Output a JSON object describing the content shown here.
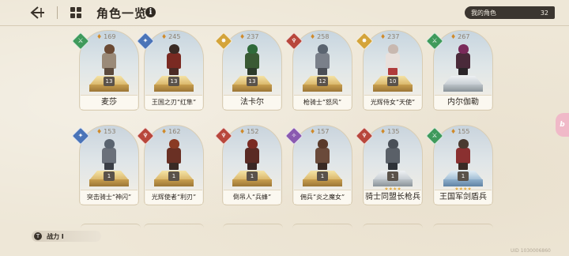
{
  "header": {
    "back_icon": "back-arrow-icon",
    "menu_icon": "grid-menu-icon",
    "title": "角色一览",
    "info_symbol": "i",
    "my_characters_label": "我的角色",
    "my_characters_count": "32"
  },
  "cards": [
    {
      "name": "麦莎",
      "power": "169",
      "level": "13",
      "class_color": "#3f9a5c",
      "class_glyph": "⚔",
      "ped": "gold",
      "head": "#6b4a34",
      "body": "#9a8a78",
      "legs": "#5b4a3c",
      "big": true
    },
    {
      "name": "王国之刃“红隼”",
      "power": "245",
      "level": "13",
      "class_color": "#4a74b8",
      "class_glyph": "✦",
      "ped": "gold",
      "head": "#3a2a24",
      "body": "#7a2a22",
      "legs": "#4a2a24",
      "big": false
    },
    {
      "name": "法卡尔",
      "power": "237",
      "level": "13",
      "class_color": "#d4a43a",
      "class_glyph": "✸",
      "ped": "gold",
      "head": "#2f6a3a",
      "body": "#3a5a34",
      "legs": "#2c3a2a",
      "big": true
    },
    {
      "name": "枪骑士“怒风”",
      "power": "258",
      "level": "12",
      "class_color": "#b8473c",
      "class_glyph": "♆",
      "ped": "gold",
      "head": "#5a6470",
      "body": "#7a808a",
      "legs": "#4a4e56",
      "big": false
    },
    {
      "name": "光辉侍女“天使”",
      "power": "237",
      "level": "10",
      "class_color": "#d4a43a",
      "class_glyph": "✸",
      "ped": "gold",
      "head": "#c8b8b0",
      "body": "#e8e0dc",
      "legs": "#b03a3a",
      "big": false
    },
    {
      "name": "内尔伽勒",
      "power": "267",
      "level": "",
      "class_color": "#3f9a5c",
      "class_glyph": "⚔",
      "ped": "silver",
      "head": "#7a2a5a",
      "body": "#4a2a3a",
      "legs": "#2a2428",
      "big": true
    },
    {
      "name": "突击骑士“神闪”",
      "power": "153",
      "level": "1",
      "class_color": "#4a74b8",
      "class_glyph": "✦",
      "ped": "gold",
      "head": "#5a6470",
      "body": "#6a707a",
      "legs": "#3a3e46",
      "big": false
    },
    {
      "name": "光辉使者“利刃”",
      "power": "162",
      "level": "1",
      "class_color": "#b8473c",
      "class_glyph": "♆",
      "ped": "gold",
      "head": "#8a3a24",
      "body": "#6a3024",
      "legs": "#3a2a24",
      "big": false
    },
    {
      "name": "倒吊人“兵蜂”",
      "power": "152",
      "level": "1",
      "class_color": "#b8473c",
      "class_glyph": "♆",
      "ped": "gold",
      "head": "#7a2a22",
      "body": "#5a2a24",
      "legs": "#3a2624",
      "big": false
    },
    {
      "name": "佣兵“炎之魔女”",
      "power": "157",
      "level": "1",
      "class_color": "#8a5ab0",
      "class_glyph": "✧",
      "ped": "gold",
      "head": "#5a3a2a",
      "body": "#6a4a3a",
      "legs": "#3a2a24",
      "big": false
    },
    {
      "name": "骑士同盟长枪兵",
      "power": "135",
      "level": "1",
      "class_color": "#b8473c",
      "class_glyph": "♆",
      "ped": "silver",
      "head": "#4a5058",
      "body": "#5a6068",
      "legs": "#2e3238",
      "big": true
    },
    {
      "name": "王国军剑盾兵",
      "power": "155",
      "level": "1",
      "class_color": "#3f9a5c",
      "class_glyph": "⚔",
      "ped": "blue",
      "head": "#4a3a30",
      "body": "#8a3030",
      "legs": "#3a2a24",
      "big": true
    }
  ],
  "stars_label": "★★★★",
  "footer": {
    "power_icon_glyph": "T",
    "power_label": "战力 Ⅰ",
    "side_tab_label": "b",
    "uid": "UID 1030006860"
  }
}
